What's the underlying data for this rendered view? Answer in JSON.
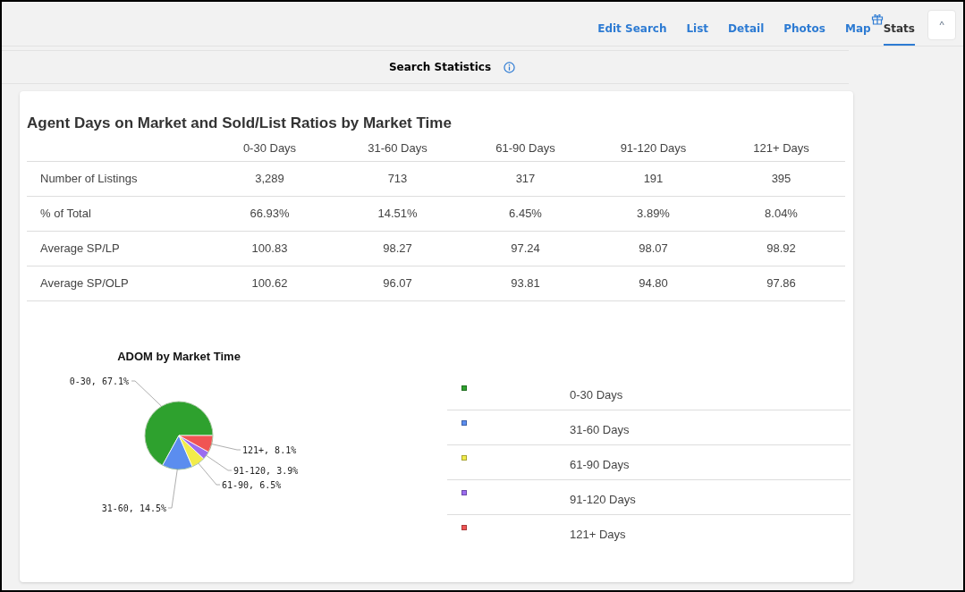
{
  "nav": {
    "tabs": [
      {
        "label": "Edit Search",
        "selected": false
      },
      {
        "label": "List",
        "selected": false
      },
      {
        "label": "Detail",
        "selected": false
      },
      {
        "label": "Photos",
        "selected": false
      },
      {
        "label": "Map",
        "selected": false
      },
      {
        "label": "Stats",
        "selected": true
      }
    ],
    "collapse_button": "^"
  },
  "section_title": "Search Statistics",
  "card": {
    "title": "Agent Days on Market and Sold/List Ratios by Market Time",
    "table": {
      "columns": [
        "0-30 Days",
        "31-60 Days",
        "61-90 Days",
        "91-120 Days",
        "121+ Days"
      ],
      "rows": [
        {
          "label": "Number of Listings",
          "cells": [
            "3,289",
            "713",
            "317",
            "191",
            "395"
          ]
        },
        {
          "label": "% of Total",
          "cells": [
            "66.93%",
            "14.51%",
            "6.45%",
            "3.89%",
            "8.04%"
          ]
        },
        {
          "label": "Average SP/LP",
          "cells": [
            "100.83",
            "98.27",
            "97.24",
            "98.07",
            "98.92"
          ]
        },
        {
          "label": "Average SP/OLP",
          "cells": [
            "100.62",
            "96.07",
            "93.81",
            "94.80",
            "97.86"
          ]
        }
      ]
    },
    "chart_data": {
      "type": "pie",
      "title": "ADOM by Market Time",
      "values": [
        67.1,
        14.5,
        6.5,
        3.9,
        8.1
      ],
      "value_labels": [
        "0-30, 67.1%",
        "31-60, 14.5%",
        "61-90, 6.5%",
        "91-120, 3.9%",
        "121+, 8.1%"
      ]
    },
    "legend": [
      {
        "label": "0-30 Days",
        "color": "#2ea12e"
      },
      {
        "label": "31-60 Days",
        "color": "#5b8def"
      },
      {
        "label": "61-90 Days",
        "color": "#f2ec4a"
      },
      {
        "label": "91-120 Days",
        "color": "#9b6cf0"
      },
      {
        "label": "121+ Days",
        "color": "#f05454"
      }
    ]
  }
}
